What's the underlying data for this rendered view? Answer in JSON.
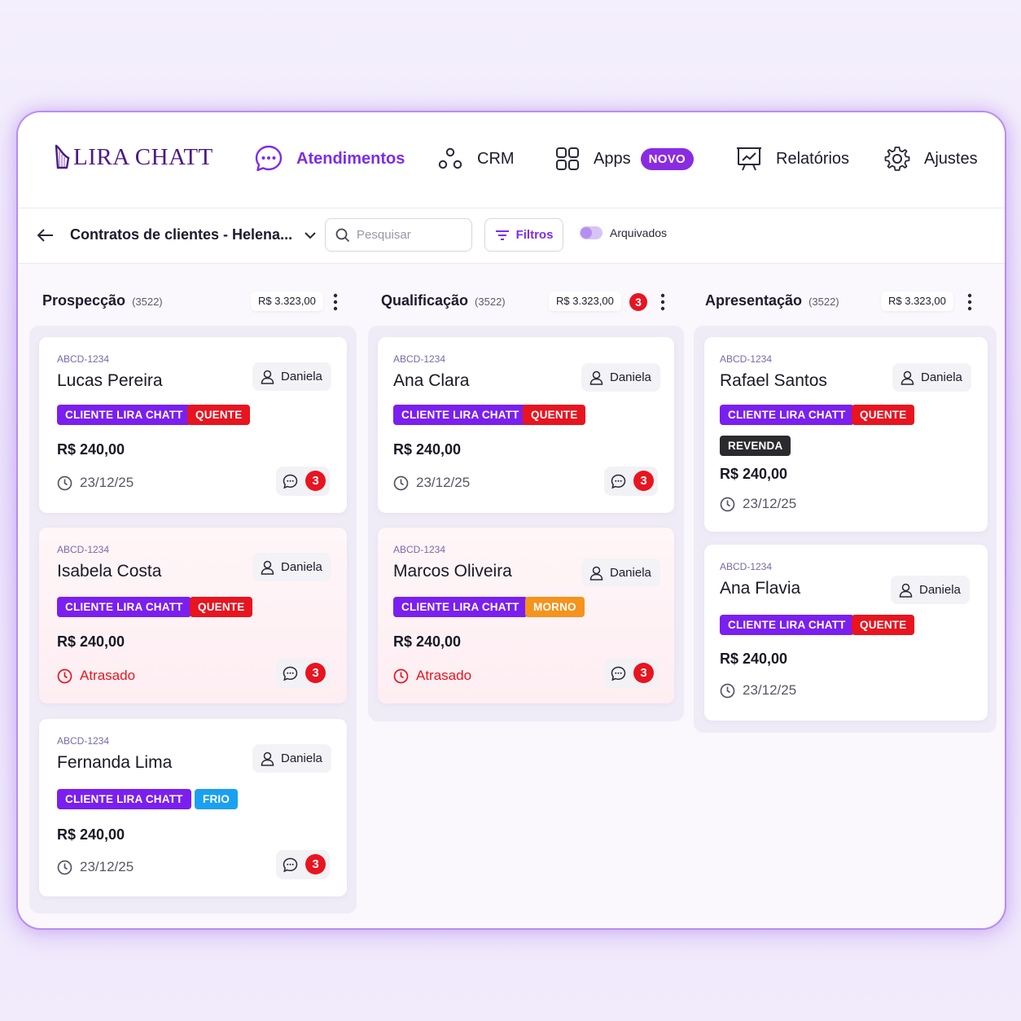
{
  "brand": {
    "name": "LIRA CHATT"
  },
  "nav": {
    "atendimentos": "Atendimentos",
    "crm": "CRM",
    "apps": "Apps",
    "apps_badge": "NOVO",
    "relatorios": "Relatórios",
    "ajustes": "Ajustes"
  },
  "toolbar": {
    "board_title": "Contratos de clientes - Helena...",
    "search_placeholder": "Pesquisar",
    "filters_label": "Filtros",
    "archived_label": "Arquivados"
  },
  "colors": {
    "accent": "#7c2cf0",
    "tag_purple": "#7a1ff0",
    "tag_red": "#e8141f",
    "tag_orange": "#f5931c",
    "tag_blue": "#1aa0f0",
    "tag_dark": "#2b2b2f"
  },
  "columns": [
    {
      "title": "Prospecção",
      "count": "(3522)",
      "total": "R$ 3.323,00",
      "cards": [
        {
          "code": "ABCD-1234",
          "name": "Lucas Pereira",
          "assignee": "Daniela",
          "tags": [
            "CLIENTE LIRA CHATT",
            "QUENTE"
          ],
          "price": "R$ 240,00",
          "date": "23/12/25",
          "messages": "3"
        },
        {
          "code": "ABCD-1234",
          "name": "Isabela  Costa",
          "assignee": "Daniela",
          "tags": [
            "CLIENTE LIRA CHATT",
            "QUENTE"
          ],
          "price": "R$ 240,00",
          "date": "Atrasado",
          "messages": "3"
        },
        {
          "code": "ABCD-1234",
          "name": "Fernanda Lima",
          "assignee": "Daniela",
          "tags": [
            "CLIENTE LIRA CHATT",
            "FRIO"
          ],
          "price": "R$ 240,00",
          "date": "23/12/25",
          "messages": "3"
        }
      ]
    },
    {
      "title": "Qualificação",
      "count": "(3522)",
      "total": "R$ 3.323,00",
      "notifications": "3",
      "cards": [
        {
          "code": "ABCD-1234",
          "name": "Ana Clara",
          "assignee": "Daniela",
          "tags": [
            "CLIENTE LIRA CHATT",
            "QUENTE"
          ],
          "price": "R$ 240,00",
          "date": "23/12/25",
          "messages": "3"
        },
        {
          "code": "ABCD-1234",
          "name": "Marcos Oliveira",
          "assignee": "Daniela",
          "tags": [
            "CLIENTE LIRA CHATT",
            "MORNO"
          ],
          "price": "R$ 240,00",
          "date": "Atrasado",
          "messages": "3"
        }
      ]
    },
    {
      "title": "Apresentação",
      "count": "(3522)",
      "total": "R$ 3.323,00",
      "cards": [
        {
          "code": "ABCD-1234",
          "name": "Rafael Santos",
          "assignee": "Daniela",
          "tags": [
            "CLIENTE LIRA CHATT",
            "QUENTE",
            "REVENDA"
          ],
          "price": "R$ 240,00",
          "date": "23/12/25"
        },
        {
          "code": "ABCD-1234",
          "name": "Ana Flavia",
          "assignee": "Daniela",
          "tags": [
            "CLIENTE LIRA CHATT",
            "QUENTE"
          ],
          "price": "R$ 240,00",
          "date": "23/12/25"
        }
      ]
    }
  ]
}
